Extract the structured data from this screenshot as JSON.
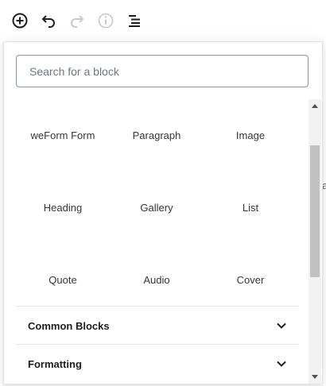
{
  "toolbar": {
    "buttons": [
      {
        "name": "add-block",
        "icon": "plus-circle-icon",
        "enabled": true
      },
      {
        "name": "undo",
        "icon": "undo-icon",
        "enabled": true
      },
      {
        "name": "redo",
        "icon": "redo-icon",
        "enabled": false
      },
      {
        "name": "content-info",
        "icon": "info-icon",
        "enabled": false
      },
      {
        "name": "block-navigation",
        "icon": "list-icon",
        "enabled": true
      }
    ]
  },
  "inserter": {
    "search": {
      "placeholder": "Search for a block",
      "value": ""
    },
    "blocks": [
      {
        "label": "weForm Form"
      },
      {
        "label": "Paragraph"
      },
      {
        "label": "Image"
      },
      {
        "label": "Heading"
      },
      {
        "label": "Gallery"
      },
      {
        "label": "List"
      },
      {
        "label": "Quote"
      },
      {
        "label": "Audio"
      },
      {
        "label": "Cover"
      }
    ],
    "sections": [
      {
        "title": "Common Blocks",
        "icon": "chevron-down-icon"
      },
      {
        "title": "Formatting",
        "icon": "chevron-down-icon"
      }
    ]
  },
  "background_edge_text": "a",
  "colors": {
    "icon_dark": "#1e1e1e",
    "icon_disabled": "#c5c9ce",
    "border": "#e2e4e7",
    "scrollbar_track": "#f1f1f1",
    "scrollbar_thumb": "#c1c1c1"
  }
}
